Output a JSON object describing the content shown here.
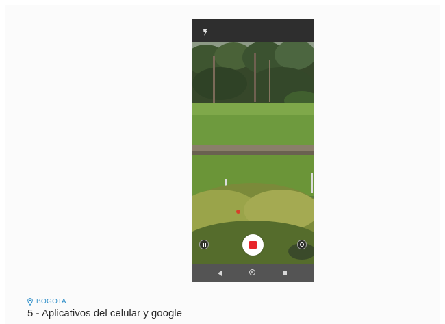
{
  "article": {
    "location": "BOGOTA",
    "title": "5 - Aplicativos del celular y google"
  },
  "phone": {
    "status_bar_icon": "flash-icon",
    "controls": [
      "pause-icon",
      "record-stop-icon",
      "settings-icon"
    ],
    "nav_icons": [
      "back-icon",
      "home-icon",
      "recents-icon"
    ],
    "colors": {
      "record": "#e8242a",
      "status_bar": "#2e2e2e",
      "nav_bar": "#545454",
      "location": "#2f8fc9"
    }
  }
}
